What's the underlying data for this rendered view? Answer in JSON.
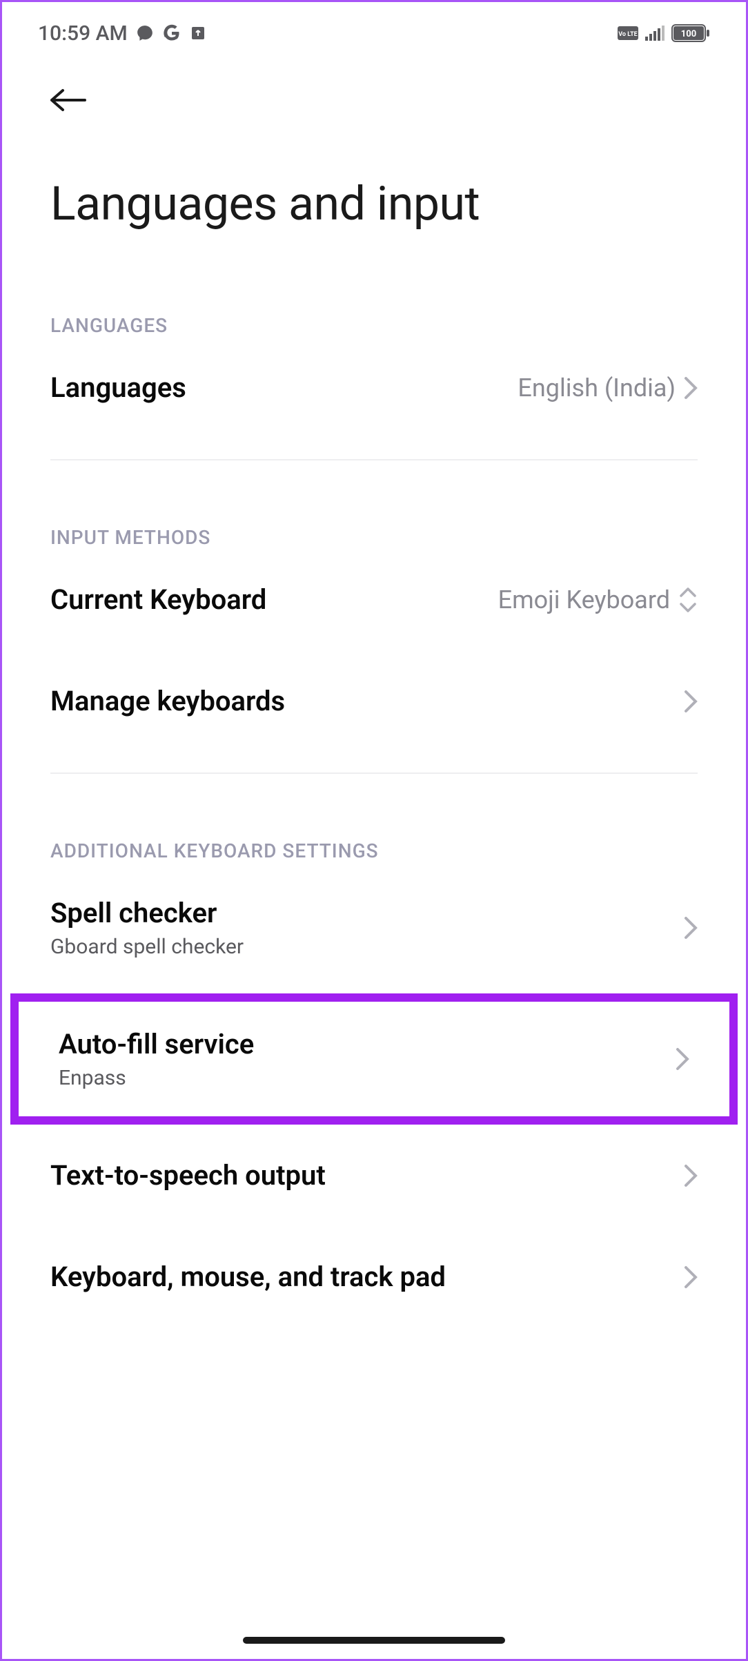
{
  "status_bar": {
    "time": "10:59 AM",
    "battery": "100"
  },
  "page_title": "Languages and input",
  "sections": {
    "languages": {
      "header": "LANGUAGES",
      "items": {
        "languages": {
          "label": "Languages",
          "value": "English (India)"
        }
      }
    },
    "input_methods": {
      "header": "INPUT METHODS",
      "items": {
        "current_keyboard": {
          "label": "Current Keyboard",
          "value": "Emoji Keyboard"
        },
        "manage_keyboards": {
          "label": "Manage keyboards"
        }
      }
    },
    "additional": {
      "header": "ADDITIONAL KEYBOARD SETTINGS",
      "items": {
        "spell_checker": {
          "label": "Spell checker",
          "sub": "Gboard spell checker"
        },
        "autofill": {
          "label": "Auto-fill service",
          "sub": "Enpass"
        },
        "tts": {
          "label": "Text-to-speech output"
        },
        "kmt": {
          "label": "Keyboard, mouse, and track pad"
        }
      }
    }
  }
}
